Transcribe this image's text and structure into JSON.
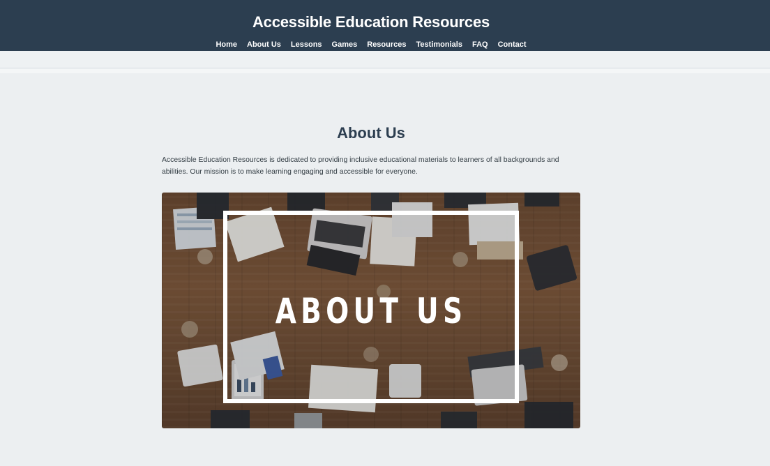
{
  "header": {
    "site_title": "Accessible Education Resources",
    "nav": [
      "Home",
      "About Us",
      "Lessons",
      "Games",
      "Resources",
      "Testimonials",
      "FAQ",
      "Contact"
    ]
  },
  "about": {
    "heading": "About Us",
    "paragraph": "Accessible Education Resources is dedicated to providing inclusive educational materials to learners of all backgrounds and abilities. Our mission is to make learning engaging and accessible for everyone.",
    "hero_image": {
      "overlay_text": "ABOUT US",
      "description_icon": "office-desk-photo"
    }
  },
  "colors": {
    "header_bg": "#2c3e50",
    "page_bg": "#eceff1",
    "heading": "#2c3e50"
  }
}
